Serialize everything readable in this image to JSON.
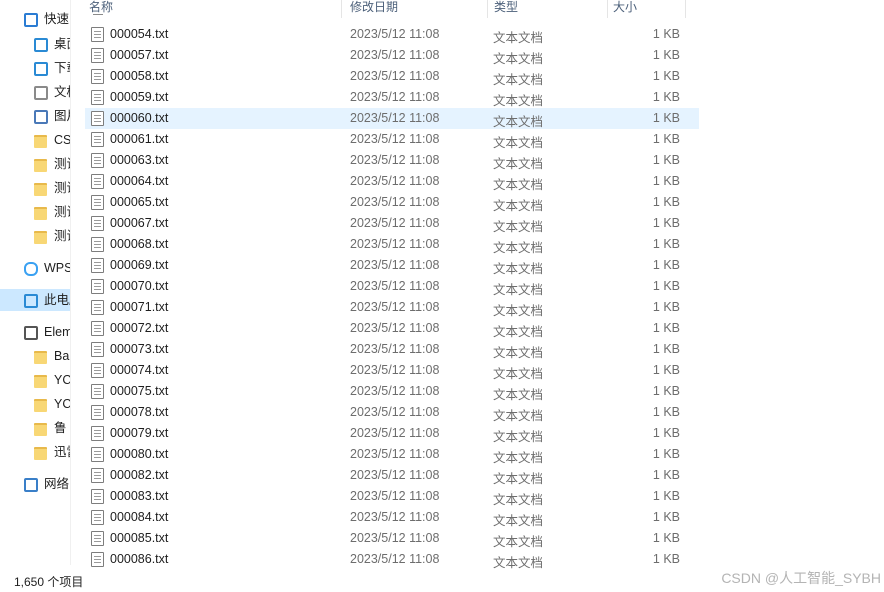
{
  "nav": {
    "items": [
      {
        "label": "快速",
        "icon": "quick-access-star-icon"
      },
      {
        "label": "桌面",
        "icon": "desktop-icon"
      },
      {
        "label": "下载",
        "icon": "download-arrow-icon"
      },
      {
        "label": "文档",
        "icon": "document-icon"
      },
      {
        "label": "图片",
        "icon": "pictures-icon"
      },
      {
        "label": "CS",
        "icon": "folder-icon"
      },
      {
        "label": "测试",
        "icon": "folder-icon"
      },
      {
        "label": "测试",
        "icon": "folder-icon"
      },
      {
        "label": "测试",
        "icon": "folder-icon"
      },
      {
        "label": "测试",
        "icon": "folder-icon"
      },
      {
        "label": "WPS",
        "icon": "cloud-icon"
      },
      {
        "label": "此电脑",
        "icon": "computer-icon"
      },
      {
        "label": "Elem",
        "icon": "drive-icon"
      },
      {
        "label": "Ba",
        "icon": "folder-icon"
      },
      {
        "label": "YC",
        "icon": "folder-icon"
      },
      {
        "label": "YC",
        "icon": "folder-icon"
      },
      {
        "label": "鲁",
        "icon": "folder-icon"
      },
      {
        "label": "迅雷",
        "icon": "folder-icon"
      },
      {
        "label": "网络",
        "icon": "network-icon"
      }
    ]
  },
  "columns": {
    "name": "名称",
    "date": "修改日期",
    "type": "类型",
    "size": "大小"
  },
  "files": [
    {
      "name": "000054.txt",
      "date": "2023/5/12 11:08",
      "type": "文本文档",
      "size": "1 KB"
    },
    {
      "name": "000057.txt",
      "date": "2023/5/12 11:08",
      "type": "文本文档",
      "size": "1 KB"
    },
    {
      "name": "000058.txt",
      "date": "2023/5/12 11:08",
      "type": "文本文档",
      "size": "1 KB"
    },
    {
      "name": "000059.txt",
      "date": "2023/5/12 11:08",
      "type": "文本文档",
      "size": "1 KB"
    },
    {
      "name": "000060.txt",
      "date": "2023/5/12 11:08",
      "type": "文本文档",
      "size": "1 KB"
    },
    {
      "name": "000061.txt",
      "date": "2023/5/12 11:08",
      "type": "文本文档",
      "size": "1 KB"
    },
    {
      "name": "000063.txt",
      "date": "2023/5/12 11:08",
      "type": "文本文档",
      "size": "1 KB"
    },
    {
      "name": "000064.txt",
      "date": "2023/5/12 11:08",
      "type": "文本文档",
      "size": "1 KB"
    },
    {
      "name": "000065.txt",
      "date": "2023/5/12 11:08",
      "type": "文本文档",
      "size": "1 KB"
    },
    {
      "name": "000067.txt",
      "date": "2023/5/12 11:08",
      "type": "文本文档",
      "size": "1 KB"
    },
    {
      "name": "000068.txt",
      "date": "2023/5/12 11:08",
      "type": "文本文档",
      "size": "1 KB"
    },
    {
      "name": "000069.txt",
      "date": "2023/5/12 11:08",
      "type": "文本文档",
      "size": "1 KB"
    },
    {
      "name": "000070.txt",
      "date": "2023/5/12 11:08",
      "type": "文本文档",
      "size": "1 KB"
    },
    {
      "name": "000071.txt",
      "date": "2023/5/12 11:08",
      "type": "文本文档",
      "size": "1 KB"
    },
    {
      "name": "000072.txt",
      "date": "2023/5/12 11:08",
      "type": "文本文档",
      "size": "1 KB"
    },
    {
      "name": "000073.txt",
      "date": "2023/5/12 11:08",
      "type": "文本文档",
      "size": "1 KB"
    },
    {
      "name": "000074.txt",
      "date": "2023/5/12 11:08",
      "type": "文本文档",
      "size": "1 KB"
    },
    {
      "name": "000075.txt",
      "date": "2023/5/12 11:08",
      "type": "文本文档",
      "size": "1 KB"
    },
    {
      "name": "000078.txt",
      "date": "2023/5/12 11:08",
      "type": "文本文档",
      "size": "1 KB"
    },
    {
      "name": "000079.txt",
      "date": "2023/5/12 11:08",
      "type": "文本文档",
      "size": "1 KB"
    },
    {
      "name": "000080.txt",
      "date": "2023/5/12 11:08",
      "type": "文本文档",
      "size": "1 KB"
    },
    {
      "name": "000082.txt",
      "date": "2023/5/12 11:08",
      "type": "文本文档",
      "size": "1 KB"
    },
    {
      "name": "000083.txt",
      "date": "2023/5/12 11:08",
      "type": "文本文档",
      "size": "1 KB"
    },
    {
      "name": "000084.txt",
      "date": "2023/5/12 11:08",
      "type": "文本文档",
      "size": "1 KB"
    },
    {
      "name": "000085.txt",
      "date": "2023/5/12 11:08",
      "type": "文本文档",
      "size": "1 KB"
    },
    {
      "name": "000086.txt",
      "date": "2023/5/12 11:08",
      "type": "文本文档",
      "size": "1 KB"
    }
  ],
  "hovered_row": 4,
  "status": {
    "item_count": "1,650 个项目"
  },
  "watermark": "CSDN @人工智能_SYBH",
  "colors": {
    "hover": "#e5f3ff",
    "selected_nav": "#cce8ff",
    "folder": "#f8d775"
  }
}
